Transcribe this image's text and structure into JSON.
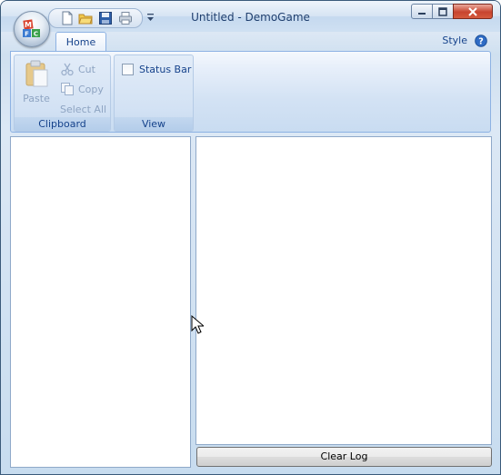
{
  "window": {
    "title": "Untitled - DemoGame"
  },
  "app_button": {
    "logo_letters": [
      "M",
      "F",
      "C"
    ]
  },
  "quick_access": [
    "new-file-icon",
    "open-folder-icon",
    "save-icon",
    "print-icon"
  ],
  "ribbon": {
    "tabs": [
      {
        "label": "Home"
      }
    ],
    "style_label": "Style",
    "groups": {
      "clipboard": {
        "label": "Clipboard",
        "paste": "Paste",
        "cut": "Cut",
        "copy": "Copy",
        "select_all": "Select All"
      },
      "view": {
        "label": "View",
        "status_bar": "Status Bar"
      }
    }
  },
  "log": {
    "clear_button": "Clear Log"
  },
  "colors": {
    "accent": "#15428b",
    "ribbon_border": "#8db2e3",
    "close_button": "#c8442f"
  }
}
